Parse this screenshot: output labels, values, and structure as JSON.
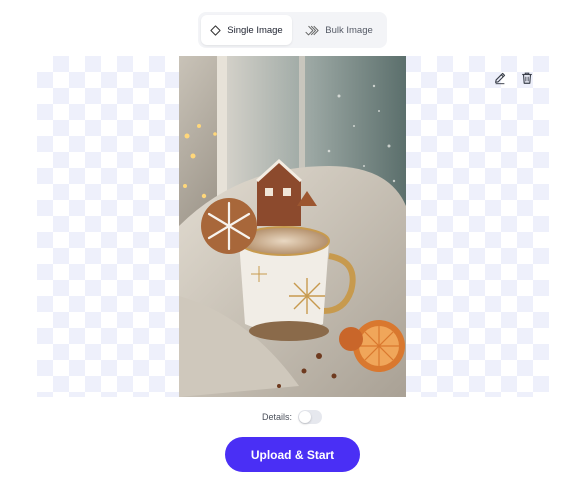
{
  "mode_toggle": {
    "single_label": "Single Image",
    "bulk_label": "Bulk Image",
    "selected": "Single Image"
  },
  "preview": {
    "photo_description_icon": "cozy-cocoa-photo",
    "edit_icon": "pencil-icon",
    "delete_icon": "trash-icon"
  },
  "details": {
    "label": "Details:",
    "enabled": false
  },
  "upload_button": {
    "label": "Upload & Start"
  },
  "colors": {
    "accent": "#4a2ff5",
    "checker": "#eef0fb"
  }
}
